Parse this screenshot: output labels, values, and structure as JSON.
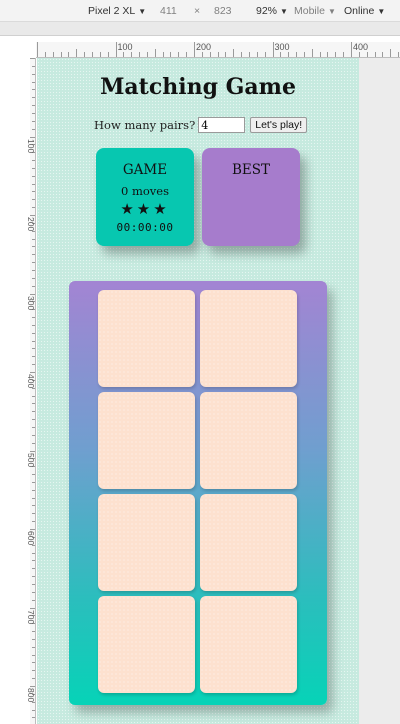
{
  "devtools": {
    "device": "Pixel 2 XL",
    "width": "411",
    "times": "×",
    "height": "823",
    "zoom": "92%",
    "mode": "Mobile",
    "network": "Online",
    "dropdown_icon": "caret-down-icon"
  },
  "ruler": {
    "h_labels": [
      "100",
      "200",
      "300",
      "400"
    ],
    "v_labels": [
      "100",
      "200",
      "300",
      "400",
      "500",
      "600",
      "700",
      "800"
    ]
  },
  "game": {
    "title": "Matching Game",
    "pairs_label": "How many pairs?",
    "pairs_value": "4",
    "play_label": "Let's play!",
    "game_panel": {
      "title": "GAME",
      "moves": "0 moves",
      "stars": "★★★",
      "timer": "00:00:00"
    },
    "best_panel": {
      "title": "BEST"
    },
    "card_count": 8
  },
  "colors": {
    "background": "#c6eadf",
    "game_panel": "#07c7b0",
    "best_panel": "#a67ccc",
    "board_top": "#a384d3",
    "board_bottom": "#06d3b7",
    "card": "#fde1cf"
  }
}
